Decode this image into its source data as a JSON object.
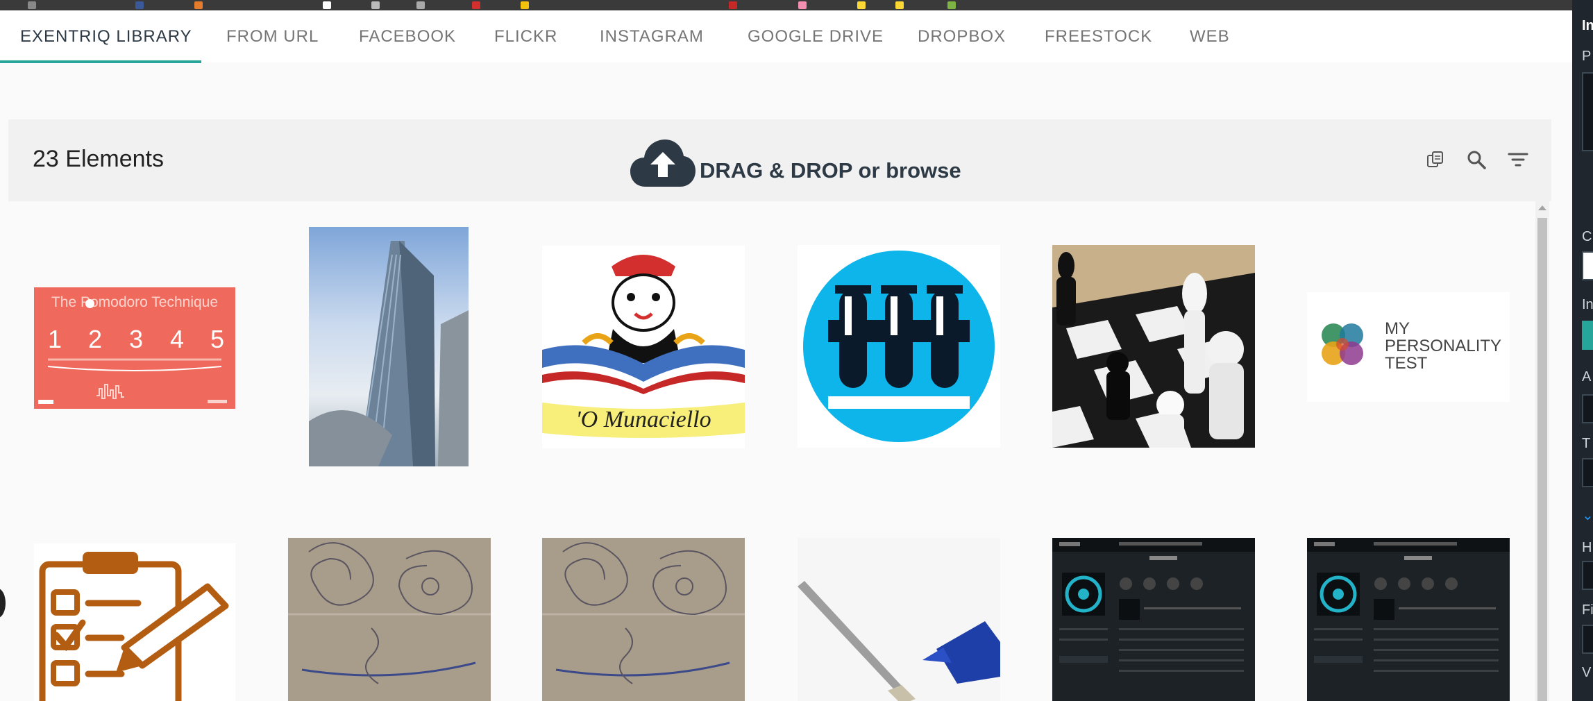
{
  "tabs": [
    {
      "label": "EXENTRIQ LIBRARY",
      "active": true
    },
    {
      "label": "FROM URL"
    },
    {
      "label": "FACEBOOK"
    },
    {
      "label": "FLICKR"
    },
    {
      "label": "INSTAGRAM"
    },
    {
      "label": "GOOGLE DRIVE"
    },
    {
      "label": "DROPBOX"
    },
    {
      "label": "FREESTOCK"
    },
    {
      "label": "WEB"
    }
  ],
  "library": {
    "count_label": "23 Elements",
    "upload_label": "DRAG & DROP or browse"
  },
  "tiles": {
    "pomodoro": {
      "title": "The Pomodoro Technique",
      "steps": [
        "1",
        "2",
        "3",
        "4",
        "5"
      ]
    },
    "munaciello": {
      "caption": "'O Munaciello"
    },
    "personality": {
      "lines": [
        "MY",
        "PERSONALITY",
        "TEST"
      ]
    }
  },
  "right_panel": {
    "letters": [
      "In",
      "P",
      "C",
      "In",
      "A",
      "T",
      "H",
      "Fi",
      "V"
    ]
  },
  "colors": {
    "accent": "#26a69a",
    "active_tab": "#2d3a45",
    "tab_text": "#757575",
    "upload": "#2d3a45"
  }
}
